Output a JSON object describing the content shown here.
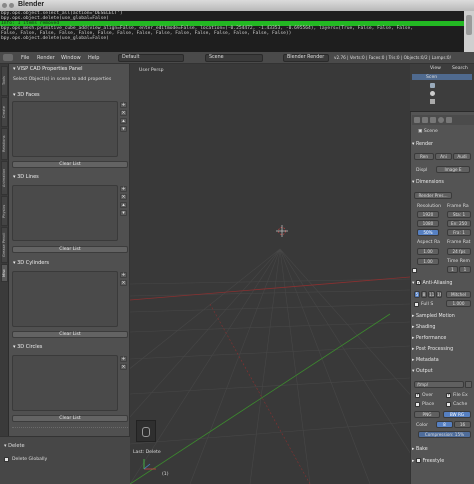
{
  "window": {
    "title": "Blender"
  },
  "console": {
    "lines": [
      "bpy.ops.object.select_all(action='DESELECT')",
      "bpy.ops.object.delete(use_global=False)",
      "Info: 1 items removed",
      "bpy.ops.mesh.primitive_cube_add(view_align=False, enter_editmode=False, location=(-0.254472, -1.43353, -0.695564), layers=(True, False, False, False,",
      "False, False, False, False, False, False, False, False, False, False, False, False, False, False, False))",
      "bpy.ops.object.delete(use_global=False)"
    ],
    "highlight_index": 2
  },
  "menubar": {
    "items": [
      "File",
      "Render",
      "Window",
      "Help"
    ],
    "layout": "Default",
    "scene": "Scene",
    "engine": "Blender Render",
    "stats": "v2.76 | Verts:0 | Faces:0 | Tris:0 | Objects:0/2 | Lamps:0/"
  },
  "lefttabs": [
    "Tools",
    "Create",
    "Relations",
    "Animation",
    "Physics",
    "Grease Pencil",
    "Misc"
  ],
  "toolshelf": {
    "header": "VISP CAD Properties Panel",
    "hint": "Select Object(s) in scene to add properties",
    "panels": [
      {
        "title": "3D Faces",
        "clear": "Clear List"
      },
      {
        "title": "3D Lines",
        "clear": "Clear List"
      },
      {
        "title": "3D Cylinders",
        "clear": "Clear List"
      },
      {
        "title": "3D Circles",
        "clear": "Clear List"
      }
    ]
  },
  "operator": {
    "title": "Delete",
    "option": "Delete Globally"
  },
  "viewport": {
    "label": "User Persp",
    "last_op": "Last: Delete",
    "obj_count": "(1)"
  },
  "outliner": {
    "view": "View",
    "search": "Search",
    "item": "Scen"
  },
  "props": {
    "scene_name": "Scene",
    "render": {
      "title": "Render",
      "btn_render": "Ren",
      "btn_anim": "Ani",
      "btn_audio": "Audi",
      "display_label": "Displ",
      "display_value": "Image E"
    },
    "dimensions": {
      "title": "Dimensions",
      "preset": "Render Pres...",
      "res_label": "Resolution",
      "fr_label": "Frame Ra",
      "res_x": "1920",
      "res_y": "1080",
      "res_pct": "50%",
      "start": "Sta: 1",
      "end": "En: 250",
      "step": "Fra: 1",
      "aspect_label": "Aspect Ra",
      "frame_rate_label": "Frame Rat",
      "aspect_x": "1.00",
      "aspect_y": "1.00",
      "fps": "24 fps",
      "time_remap": "Time Rem",
      "old": "1",
      "new": "1"
    },
    "aa": {
      "title": "Anti-Aliasing",
      "samples": [
        "5",
        "8",
        "11",
        "16"
      ],
      "filter": "Mitchel",
      "full": "Full S",
      "size": "1.000"
    },
    "sections": [
      "Sampled Motion",
      "Shading",
      "Performance",
      "Post Processing",
      "Metadata"
    ],
    "output": {
      "title": "Output",
      "path": "/tmp/",
      "over": "Over",
      "file_ext": "File Ex",
      "place": "Place",
      "cache": "Cache",
      "format": "PNG",
      "color_mode": "BW RG",
      "color_label": "Color",
      "depth": "8",
      "depth2": "16",
      "compression": "Compression: 15%"
    },
    "bake": "Bake",
    "freestyle": "Freestyle"
  }
}
